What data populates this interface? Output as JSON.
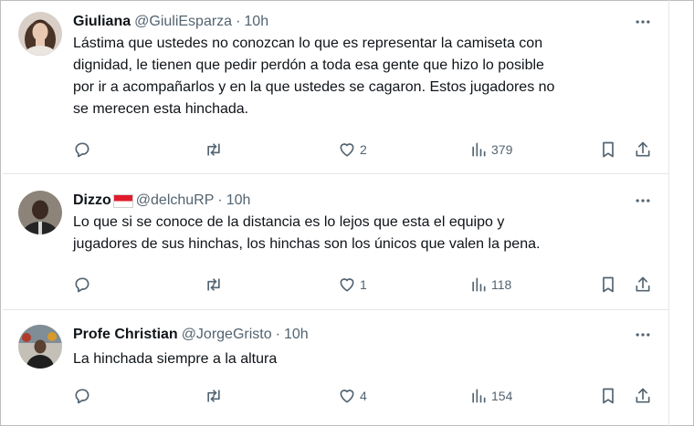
{
  "tweets": [
    {
      "name": "Giuliana",
      "handle": "@GiuliEsparza",
      "separator": "·",
      "time": "10h",
      "text_lines": [
        "Lástima que ustedes no conozcan lo que es representar la camiseta con",
        "dignidad, le tienen que pedir perdón a toda esa gente que hizo lo posible",
        "por ir a acompañarlos y en la que ustedes se cagaron. Estos jugadores no",
        "se merecen esta hinchada."
      ],
      "likes": "2",
      "views": "379",
      "name_flag": false
    },
    {
      "name": "Dizzo",
      "handle": "@delchuRP",
      "separator": "·",
      "time": "10h",
      "text_lines": [
        "Lo que si se conoce de la distancia es lo lejos que esta el equipo y",
        "jugadores de sus hinchas, los hinchas son los únicos que valen la pena."
      ],
      "likes": "1",
      "views": "118",
      "name_flag": true
    },
    {
      "name": "Profe Christian",
      "handle": "@JorgeGristo",
      "separator": "·",
      "time": "10h",
      "text_lines": [
        "La hinchada siempre a la altura"
      ],
      "likes": "4",
      "views": "154",
      "name_flag": false
    }
  ],
  "icons": {
    "more": "more-dots-icon",
    "reply": "reply-bubble-icon",
    "retweet": "retweet-icon",
    "like": "heart-icon",
    "views": "views-bar-chart-icon",
    "bookmark": "bookmark-icon",
    "share": "share-upload-icon",
    "flag": "flag-emoji-red-white"
  },
  "colors": {
    "text": "#0f1419",
    "muted": "#536471",
    "separator": "#e3e6e9",
    "flag_red": "#e21a2c"
  }
}
